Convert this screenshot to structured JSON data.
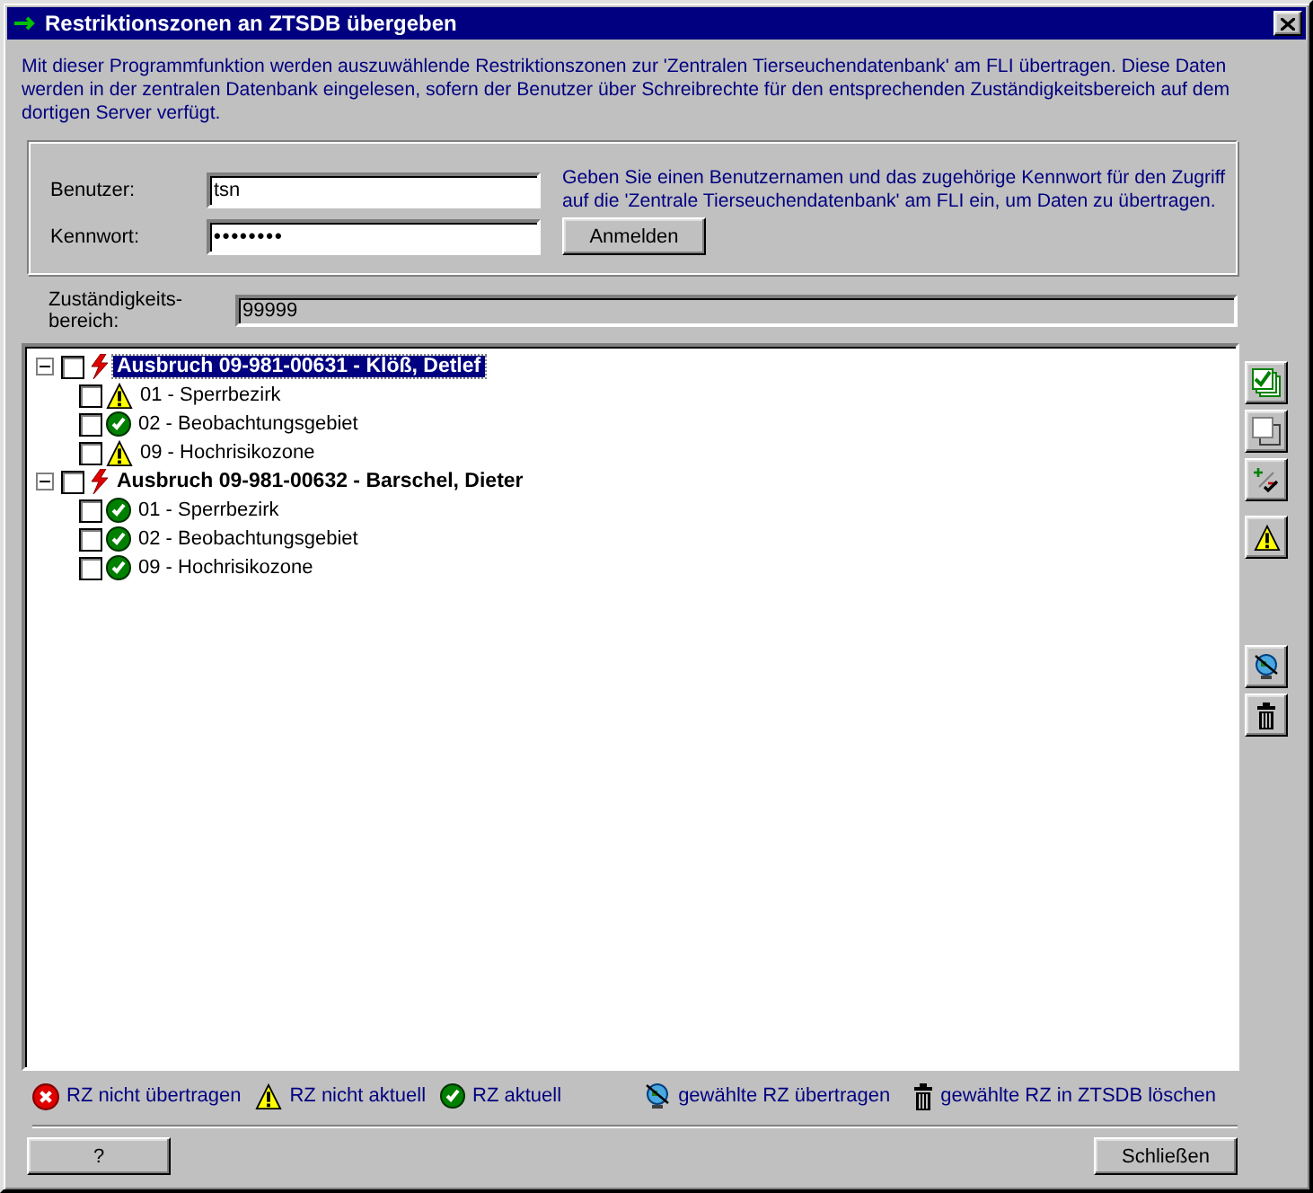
{
  "window": {
    "title": "Restriktionszonen an ZTSDB übergeben"
  },
  "description": "Mit dieser Programmfunktion werden auszuwählende Restriktionszonen zur 'Zentralen Tierseuchendatenbank' am FLI übertragen. Diese Daten werden in der zentralen Datenbank eingelesen, sofern der Benutzer über Schreibrechte für den entsprechenden Zuständigkeitsbereich auf dem dortigen Server verfügt.",
  "login": {
    "user_label": "Benutzer:",
    "user_value": "tsn",
    "password_label": "Kennwort:",
    "password_value": "••••••••",
    "hint": "Geben Sie einen Benutzernamen und das zugehörige Kennwort für den Zugriff auf die 'Zentrale Tierseuchendatenbank' am FLI ein, um Daten zu übertragen.",
    "login_button": "Anmelden"
  },
  "area": {
    "label": "Zuständigkeits-bereich:",
    "value": "99999"
  },
  "tree": [
    {
      "label": "Ausbruch 09-981-00631 - Klöß, Detlef",
      "selected": true,
      "checked": false,
      "expanded": true,
      "children": [
        {
          "label": "01 - Sperrbezirk",
          "checked": false,
          "kind": "warning"
        },
        {
          "label": "02 - Beobachtungsgebiet",
          "checked": false,
          "kind": "ok"
        },
        {
          "label": "09 - Hochrisikozone",
          "checked": false,
          "kind": "warning"
        }
      ]
    },
    {
      "label": "Ausbruch 09-981-00632 - Barschel, Dieter",
      "selected": false,
      "checked": false,
      "expanded": true,
      "children": [
        {
          "label": "01 - Sperrbezirk",
          "checked": false,
          "kind": "ok"
        },
        {
          "label": "02 - Beobachtungsgebiet",
          "checked": false,
          "kind": "ok"
        },
        {
          "label": "09 - Hochrisikozone",
          "checked": false,
          "kind": "ok"
        }
      ]
    }
  ],
  "legend": [
    {
      "kind": "error",
      "label": "RZ nicht übertragen"
    },
    {
      "kind": "warning",
      "label": "RZ nicht aktuell"
    },
    {
      "kind": "ok",
      "label": "RZ aktuell"
    },
    {
      "kind": "globe",
      "label": "gewählte RZ übertragen"
    },
    {
      "kind": "trash",
      "label": "gewählte RZ in ZTSDB löschen"
    }
  ],
  "buttons": {
    "help": "?",
    "close": "Schließen"
  }
}
